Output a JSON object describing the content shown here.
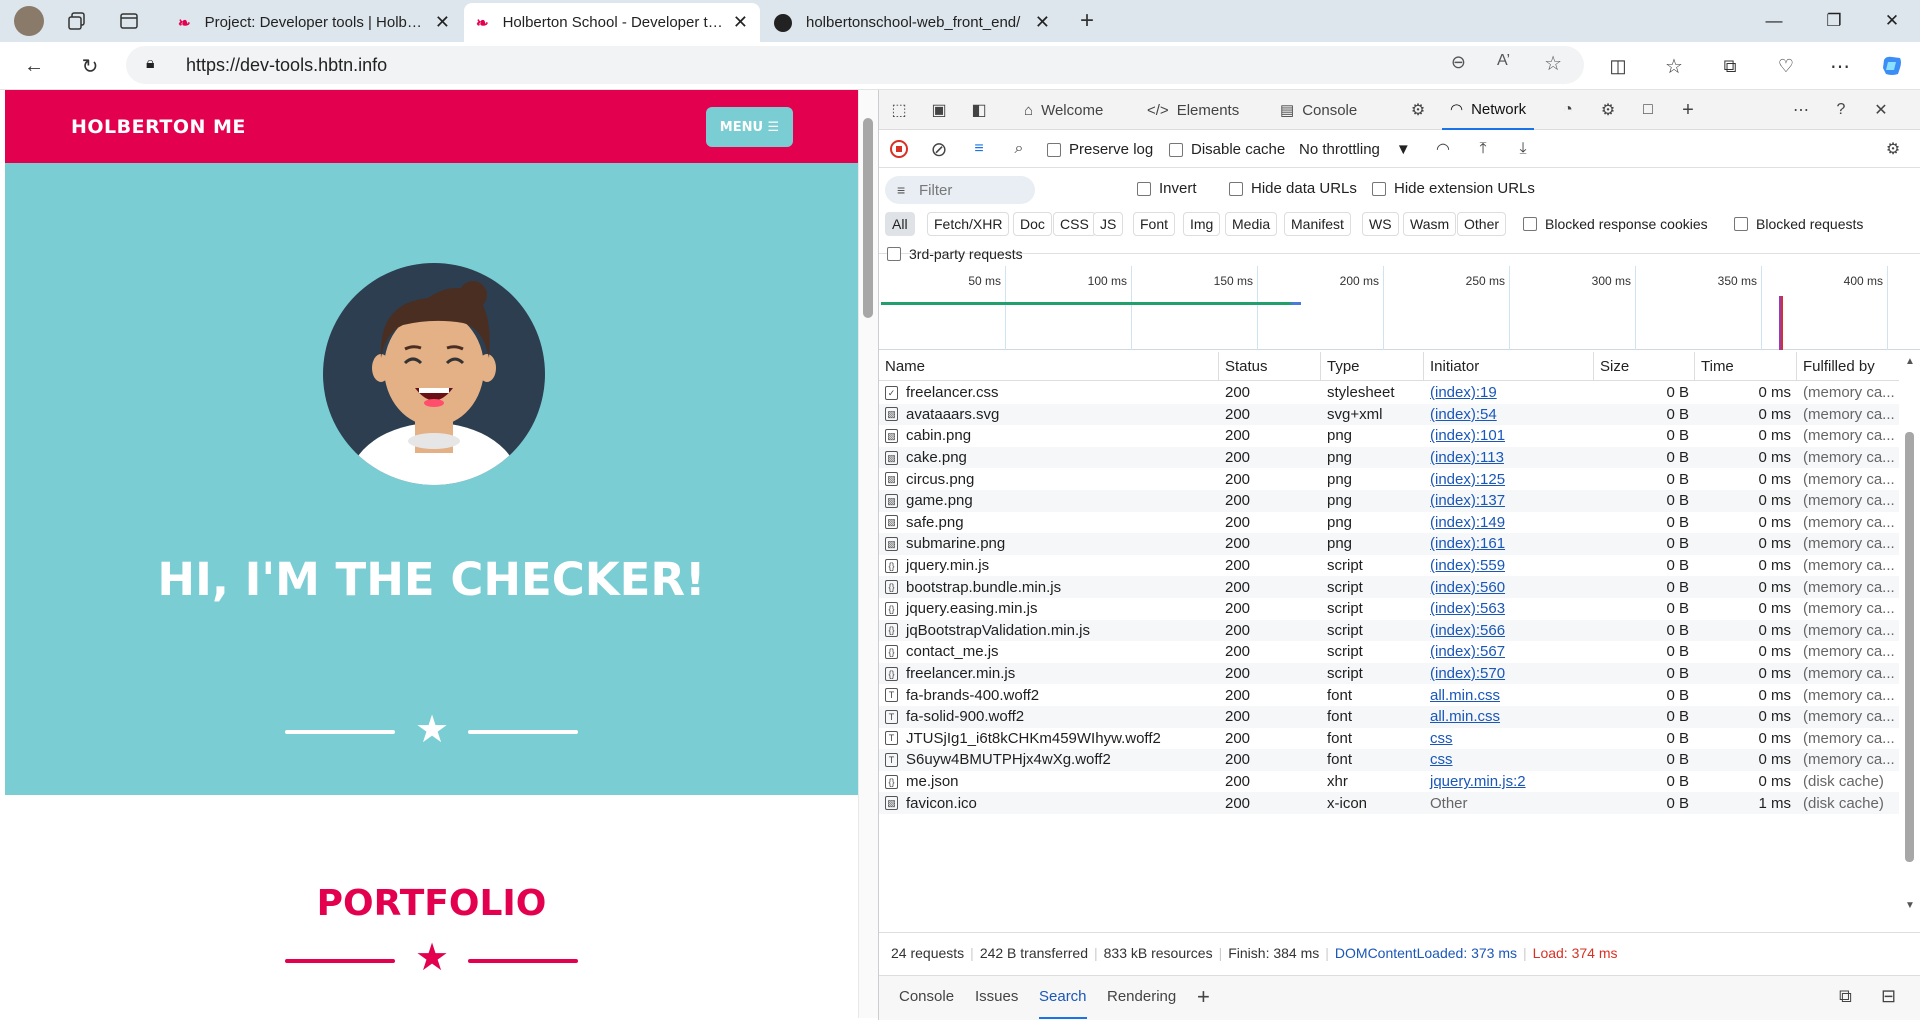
{
  "browser": {
    "tabs": [
      {
        "title": "Project: Developer tools | Holberton",
        "active": false
      },
      {
        "title": "Holberton School - Developer tools",
        "active": true
      },
      {
        "title": "holbertonschool-web_front_end/",
        "active": false
      }
    ],
    "url": "https://dev-tools.hbtn.info"
  },
  "page": {
    "brand": "HOLBERTON ME",
    "menu_label": "MENU ☰",
    "hero_title": "HI, I'M THE CHECKER!",
    "portfolio_title": "PORTFOLIO",
    "colors": {
      "primary": "#e3004f",
      "hero_bg": "#7acdd3"
    }
  },
  "devtools": {
    "tabs": [
      {
        "label": "Welcome"
      },
      {
        "label": "Elements"
      },
      {
        "label": "Console"
      },
      {
        "label": "Network"
      }
    ],
    "toolbar": {
      "preserve_log": "Preserve log",
      "disable_cache": "Disable cache",
      "throttling": "No throttling"
    },
    "filter": {
      "placeholder": "Filter",
      "invert": "Invert",
      "hide_data_urls": "Hide data URLs",
      "hide_extension_urls": "Hide extension URLs",
      "types": [
        "All",
        "Fetch/XHR",
        "Doc",
        "CSS",
        "JS",
        "Font",
        "Img",
        "Media",
        "Manifest",
        "WS",
        "Wasm",
        "Other"
      ],
      "blocked_response_cookies": "Blocked response cookies",
      "blocked_requests": "Blocked requests",
      "third_party": "3rd-party requests"
    },
    "timeline_ticks": [
      "50 ms",
      "100 ms",
      "150 ms",
      "200 ms",
      "250 ms",
      "300 ms",
      "350 ms",
      "400 ms"
    ],
    "columns": [
      "Name",
      "Status",
      "Type",
      "Initiator",
      "Size",
      "Time",
      "Fulfilled by"
    ],
    "rows": [
      {
        "name": "freelancer.css",
        "status": "200",
        "type": "stylesheet",
        "initiator": "(index):19",
        "size": "0 B",
        "time": "0 ms",
        "fulfilled": "(memory ca..."
      },
      {
        "name": "avataaars.svg",
        "status": "200",
        "type": "svg+xml",
        "initiator": "(index):54",
        "size": "0 B",
        "time": "0 ms",
        "fulfilled": "(memory ca..."
      },
      {
        "name": "cabin.png",
        "status": "200",
        "type": "png",
        "initiator": "(index):101",
        "size": "0 B",
        "time": "0 ms",
        "fulfilled": "(memory ca..."
      },
      {
        "name": "cake.png",
        "status": "200",
        "type": "png",
        "initiator": "(index):113",
        "size": "0 B",
        "time": "0 ms",
        "fulfilled": "(memory ca..."
      },
      {
        "name": "circus.png",
        "status": "200",
        "type": "png",
        "initiator": "(index):125",
        "size": "0 B",
        "time": "0 ms",
        "fulfilled": "(memory ca..."
      },
      {
        "name": "game.png",
        "status": "200",
        "type": "png",
        "initiator": "(index):137",
        "size": "0 B",
        "time": "0 ms",
        "fulfilled": "(memory ca..."
      },
      {
        "name": "safe.png",
        "status": "200",
        "type": "png",
        "initiator": "(index):149",
        "size": "0 B",
        "time": "0 ms",
        "fulfilled": "(memory ca..."
      },
      {
        "name": "submarine.png",
        "status": "200",
        "type": "png",
        "initiator": "(index):161",
        "size": "0 B",
        "time": "0 ms",
        "fulfilled": "(memory ca..."
      },
      {
        "name": "jquery.min.js",
        "status": "200",
        "type": "script",
        "initiator": "(index):559",
        "size": "0 B",
        "time": "0 ms",
        "fulfilled": "(memory ca..."
      },
      {
        "name": "bootstrap.bundle.min.js",
        "status": "200",
        "type": "script",
        "initiator": "(index):560",
        "size": "0 B",
        "time": "0 ms",
        "fulfilled": "(memory ca..."
      },
      {
        "name": "jquery.easing.min.js",
        "status": "200",
        "type": "script",
        "initiator": "(index):563",
        "size": "0 B",
        "time": "0 ms",
        "fulfilled": "(memory ca..."
      },
      {
        "name": "jqBootstrapValidation.min.js",
        "status": "200",
        "type": "script",
        "initiator": "(index):566",
        "size": "0 B",
        "time": "0 ms",
        "fulfilled": "(memory ca..."
      },
      {
        "name": "contact_me.js",
        "status": "200",
        "type": "script",
        "initiator": "(index):567",
        "size": "0 B",
        "time": "0 ms",
        "fulfilled": "(memory ca..."
      },
      {
        "name": "freelancer.min.js",
        "status": "200",
        "type": "script",
        "initiator": "(index):570",
        "size": "0 B",
        "time": "0 ms",
        "fulfilled": "(memory ca..."
      },
      {
        "name": "fa-brands-400.woff2",
        "status": "200",
        "type": "font",
        "initiator": "all.min.css",
        "size": "0 B",
        "time": "0 ms",
        "fulfilled": "(memory ca..."
      },
      {
        "name": "fa-solid-900.woff2",
        "status": "200",
        "type": "font",
        "initiator": "all.min.css",
        "size": "0 B",
        "time": "0 ms",
        "fulfilled": "(memory ca..."
      },
      {
        "name": "JTUSjIg1_i6t8kCHKm459WIhyw.woff2",
        "status": "200",
        "type": "font",
        "initiator": "css",
        "size": "0 B",
        "time": "0 ms",
        "fulfilled": "(memory ca..."
      },
      {
        "name": "S6uyw4BMUTPHjx4wXg.woff2",
        "status": "200",
        "type": "font",
        "initiator": "css",
        "size": "0 B",
        "time": "0 ms",
        "fulfilled": "(memory ca..."
      },
      {
        "name": "me.json",
        "status": "200",
        "type": "xhr",
        "initiator": "jquery.min.js:2",
        "size": "0 B",
        "time": "0 ms",
        "fulfilled": "(disk cache)"
      },
      {
        "name": "favicon.ico",
        "status": "200",
        "type": "x-icon",
        "initiator": "Other",
        "size": "0 B",
        "time": "1 ms",
        "fulfilled": "(disk cache)"
      }
    ],
    "summary": {
      "requests": "24 requests",
      "transferred": "242 B transferred",
      "resources": "833 kB resources",
      "finish": "Finish: 384 ms",
      "dom": "DOMContentLoaded: 373 ms",
      "load": "Load: 374 ms"
    },
    "drawer_tabs": [
      "Console",
      "Issues",
      "Search",
      "Rendering"
    ]
  }
}
